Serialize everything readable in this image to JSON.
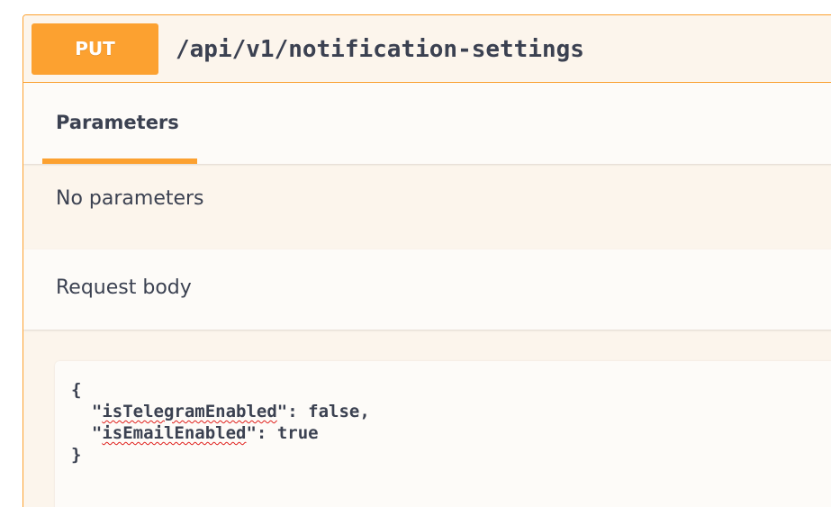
{
  "operation": {
    "method": "PUT",
    "path": "/api/v1/notification-settings"
  },
  "tabs": [
    {
      "label": "Parameters",
      "active": true
    }
  ],
  "parameters": {
    "empty_message": "No parameters"
  },
  "request_body": {
    "title": "Request body",
    "code": {
      "open_brace": "{",
      "close_brace": "}",
      "fields": [
        {
          "key": "isTelegramEnabled",
          "value": "false",
          "trailing": ","
        },
        {
          "key": "isEmailEnabled",
          "value": "true",
          "trailing": ""
        }
      ]
    }
  },
  "colors": {
    "accent": "#fca130",
    "background": "#fcf5ec",
    "text": "#3b4151",
    "spellcheck": "#e0201c"
  }
}
